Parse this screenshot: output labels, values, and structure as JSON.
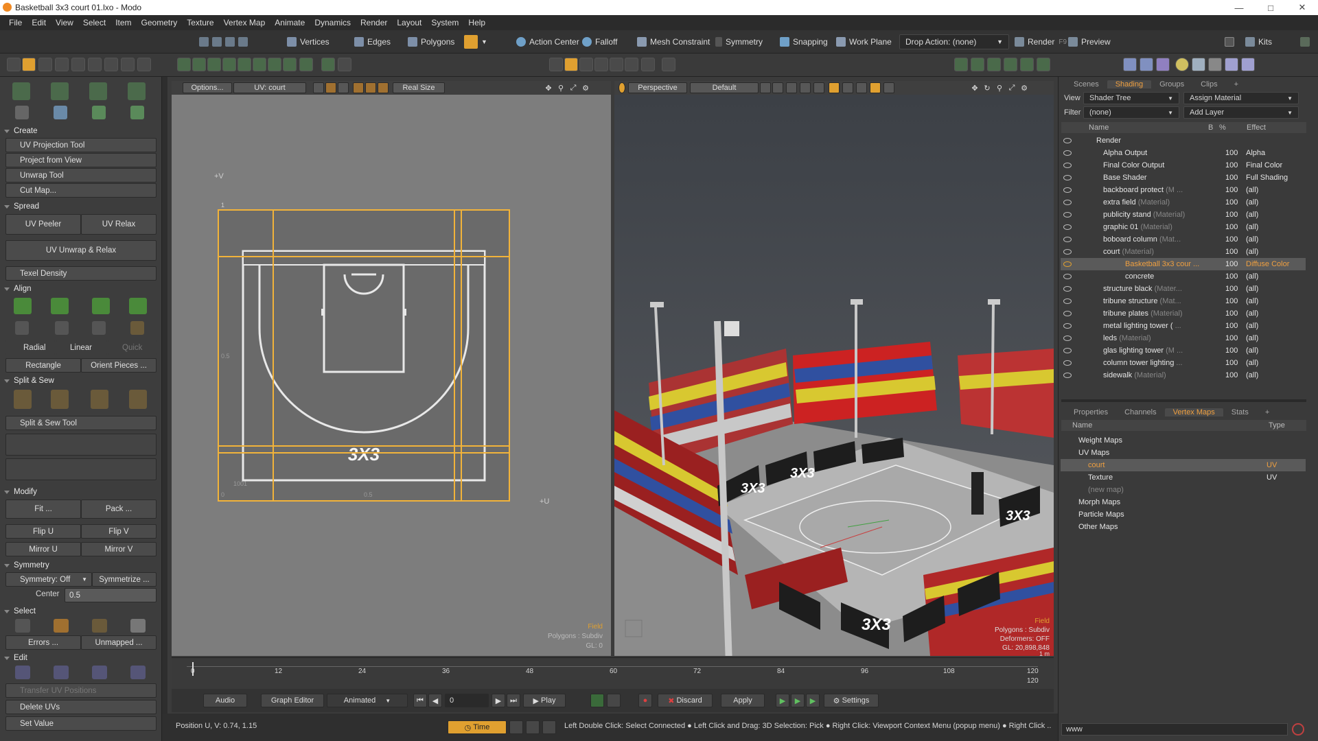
{
  "title": "Basketball 3x3 court 01.lxo - Modo",
  "menus": [
    "File",
    "Edit",
    "View",
    "Select",
    "Item",
    "Geometry",
    "Texture",
    "Vertex Map",
    "Animate",
    "Dynamics",
    "Render",
    "Layout",
    "System",
    "Help"
  ],
  "toolbar": {
    "vertices": "Vertices",
    "edges": "Edges",
    "polygons": "Polygons",
    "action_center": "Action Center",
    "falloff": "Falloff",
    "mesh_constraint": "Mesh Constraint",
    "symmetry": "Symmetry",
    "snapping": "Snapping",
    "work_plane": "Work Plane",
    "drop_action": "Drop Action: (none)",
    "render": "Render",
    "render_key": "F9",
    "preview": "Preview",
    "kits": "Kits"
  },
  "left": {
    "create": "Create",
    "uv_projection_tool": "UV Projection Tool",
    "project_from_view": "Project from View",
    "unwrap_tool": "Unwrap Tool",
    "cut_map": "Cut Map...",
    "spread": "Spread",
    "uv_peeler": "UV Peeler",
    "uv_relax": "UV Relax",
    "uv_unwrap_relax": "UV Unwrap & Relax",
    "texel_density": "Texel Density",
    "align": "Align",
    "radial": "Radial",
    "linear": "Linear",
    "quick": "Quick",
    "rectangle": "Rectangle",
    "orient_pieces": "Orient Pieces ...",
    "split_sew": "Split & Sew",
    "split_sew_tool": "Split & Sew Tool",
    "modify": "Modify",
    "fit": "Fit ...",
    "pack": "Pack ...",
    "flip_u": "Flip U",
    "flip_v": "Flip V",
    "mirror_u": "Mirror U",
    "mirror_v": "Mirror V",
    "symmetry": "Symmetry",
    "symmetry_off": "Symmetry: Off",
    "symmetrize": "Symmetrize ...",
    "center_label": "Center",
    "center_value": "0.5",
    "select": "Select",
    "errors": "Errors ...",
    "unmapped": "Unmapped ...",
    "edit": "Edit",
    "transfer_uv": "Transfer UV Positions",
    "delete_uvs": "Delete UVs",
    "set_value": "Set Value"
  },
  "uv": {
    "options": "Options...",
    "map": "UV: court",
    "real_size": "Real Size",
    "plus_v": "+V",
    "plus_u": "+U",
    "tick_05": "0.5",
    "tick_1": "1",
    "tick_0": "0",
    "tick_1001": "1001",
    "logo": "3X3",
    "info_field": "Field",
    "info_polys": "Polygons : Subdiv",
    "info_gl": "GL: 0"
  },
  "viewport": {
    "perspective": "Perspective",
    "default": "Default",
    "info_field": "Field",
    "info_polys": "Polygons : Subdiv",
    "info_deformers": "Deformers: OFF",
    "info_gl": "GL: 20,898,848",
    "info_unit": "1 m",
    "banner": "3X3"
  },
  "shading": {
    "tabs": [
      "Scenes",
      "Shading",
      "Groups",
      "Clips"
    ],
    "active_tab": "Shading",
    "view_label": "View",
    "view_value": "Shader Tree",
    "assign": "Assign Material",
    "filter_label": "Filter",
    "filter_value": "(none)",
    "add_layer": "Add Layer",
    "col_name": "Name",
    "col_b": "B",
    "col_pct": "%",
    "col_effect": "Effect",
    "rows": [
      {
        "name": "Render",
        "mat": "",
        "pct": "",
        "effect": ""
      },
      {
        "name": "Alpha Output",
        "mat": "",
        "pct": "100",
        "effect": "Alpha"
      },
      {
        "name": "Final Color Output",
        "mat": "",
        "pct": "100",
        "effect": "Final Color"
      },
      {
        "name": "Base Shader",
        "mat": "",
        "pct": "100",
        "effect": "Full Shading"
      },
      {
        "name": "backboard protect",
        "mat": "(M ...",
        "pct": "100",
        "effect": "(all)"
      },
      {
        "name": "extra field",
        "mat": "(Material)",
        "pct": "100",
        "effect": "(all)"
      },
      {
        "name": "publicity stand",
        "mat": "(Material)",
        "pct": "100",
        "effect": "(all)"
      },
      {
        "name": "graphic 01",
        "mat": "(Material)",
        "pct": "100",
        "effect": "(all)"
      },
      {
        "name": "boboard column",
        "mat": "(Mat...",
        "pct": "100",
        "effect": "(all)"
      },
      {
        "name": "court",
        "mat": "(Material)",
        "pct": "100",
        "effect": "(all)"
      },
      {
        "name": "Basketball 3x3 cour ...",
        "mat": "",
        "pct": "100",
        "effect": "Diffuse Color"
      },
      {
        "name": "concrete",
        "mat": "",
        "pct": "100",
        "effect": "(all)"
      },
      {
        "name": "structure black",
        "mat": "(Mater...",
        "pct": "100",
        "effect": "(all)"
      },
      {
        "name": "tribune structure",
        "mat": "(Mat...",
        "pct": "100",
        "effect": "(all)"
      },
      {
        "name": "tribune plates",
        "mat": "(Material)",
        "pct": "100",
        "effect": "(all)"
      },
      {
        "name": "metal lighting tower (",
        "mat": "...",
        "pct": "100",
        "effect": "(all)"
      },
      {
        "name": "leds",
        "mat": "(Material)",
        "pct": "100",
        "effect": "(all)"
      },
      {
        "name": "glas lighting tower",
        "mat": "(M ...",
        "pct": "100",
        "effect": "(all)"
      },
      {
        "name": "column tower lighting",
        "mat": "...",
        "pct": "100",
        "effect": "(all)"
      },
      {
        "name": "sidewalk",
        "mat": "(Material)",
        "pct": "100",
        "effect": "(all)"
      }
    ]
  },
  "vmaps": {
    "tabs": [
      "Properties",
      "Channels",
      "Vertex Maps",
      "Stats"
    ],
    "active_tab": "Vertex Maps",
    "col_name": "Name",
    "col_type": "Type",
    "rows": [
      {
        "name": "Weight Maps",
        "type": ""
      },
      {
        "name": "UV Maps",
        "type": ""
      },
      {
        "name": "court",
        "type": "UV"
      },
      {
        "name": "Texture",
        "type": "UV"
      },
      {
        "name": "(new map)",
        "type": ""
      },
      {
        "name": "Morph Maps",
        "type": ""
      },
      {
        "name": "Particle Maps",
        "type": ""
      },
      {
        "name": "Other Maps",
        "type": ""
      }
    ]
  },
  "timeline": {
    "ticks": [
      "0",
      "12",
      "24",
      "36",
      "48",
      "60",
      "72",
      "84",
      "96",
      "108",
      "120"
    ],
    "end": "120"
  },
  "transport": {
    "audio": "Audio",
    "graph_editor": "Graph Editor",
    "animated": "Animated",
    "frame": "0",
    "play": "Play",
    "discard": "Discard",
    "apply": "Apply",
    "settings": "Settings"
  },
  "status": {
    "position": "Position U, V:  0.74, 1.15",
    "time": "Time",
    "hint": "Left Double Click: Select Connected ● Left Click and Drag: 3D Selection: Pick ● Right Click: Viewport Context Menu (popup menu) ● Right Click ...",
    "command": "www"
  },
  "colors": {
    "accent": "#f0a040",
    "uv_bg": "#7d7d7d",
    "court_gray": "#6a6a6a",
    "seam": "#f2b33a"
  }
}
